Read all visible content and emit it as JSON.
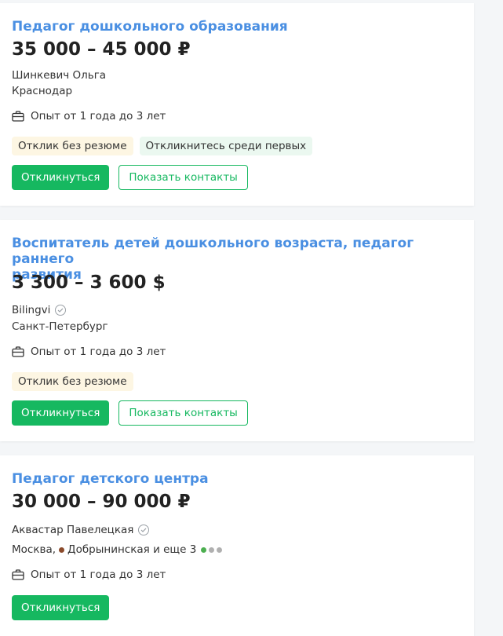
{
  "colors": {
    "title": "#4a8fe2",
    "accent": "#16b860",
    "metro_brown": "#8b4a2b",
    "line_green": "#4caf50",
    "line_gray": "#b0b0b0"
  },
  "vacancies": [
    {
      "title": "Педагог дошкольного образования",
      "salary": "35 000 – 45 000 ₽",
      "company": "Шинкевич Ольга",
      "city": "Краснодар",
      "experience": "Опыт от 1 года до 3 лет",
      "tags": [
        "Отклик без резюме",
        "Откликнитесь среди первых"
      ],
      "respond_label": "Откликнуться",
      "contacts_label": "Показать контакты"
    },
    {
      "title_line1": "Воспитатель детей дошкольного возраста, педагог раннего",
      "title_line2": "развития",
      "salary": "3 300 – 3 600 $",
      "company": "Bilingvi",
      "city": "Санкт-Петербург",
      "experience": "Опыт от 1 года до 3 лет",
      "tags": [
        "Отклик без резюме"
      ],
      "respond_label": "Откликнуться",
      "contacts_label": "Показать контакты"
    },
    {
      "title": "Педагог детского центра",
      "salary": "30 000 – 90 000 ₽",
      "company": "Аквастар Павелецкая",
      "city": "Москва,",
      "metro": "Добрынинская и еще 3",
      "experience": "Опыт от 1 года до 3 лет",
      "respond_label": "Откликнуться"
    }
  ]
}
